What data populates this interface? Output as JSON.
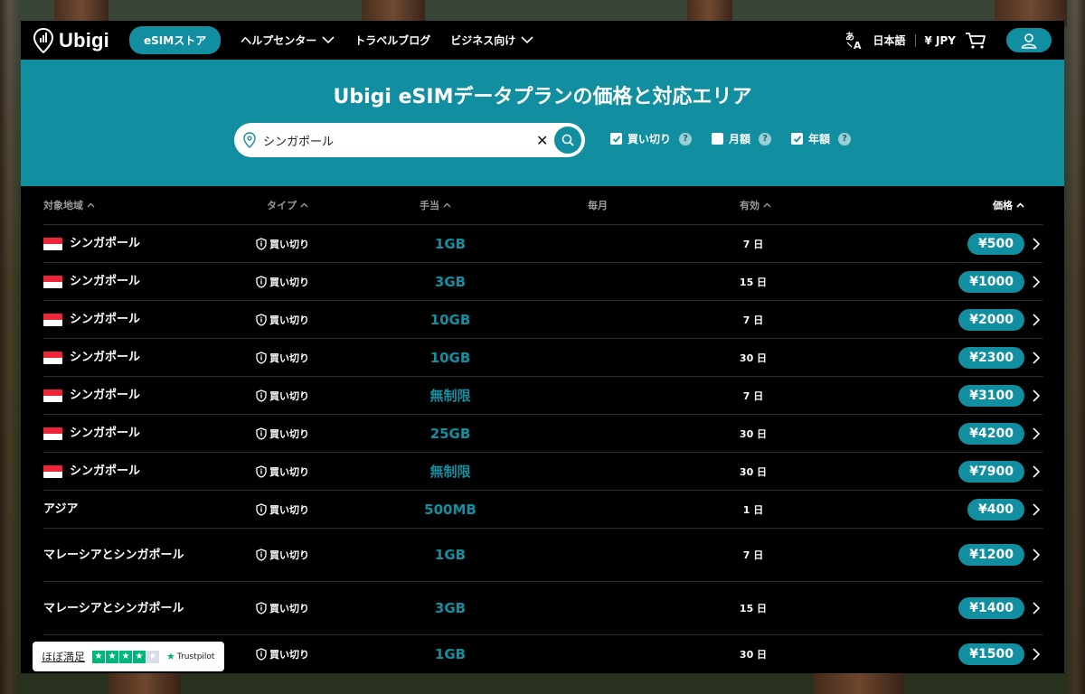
{
  "header": {
    "logo_text": "Ubigi",
    "store_label": "eSIMストア",
    "nav": [
      {
        "label": "ヘルプセンター",
        "dropdown": true
      },
      {
        "label": "トラベルブログ",
        "dropdown": false
      },
      {
        "label": "ビジネス向け",
        "dropdown": true
      }
    ],
    "language": "日本語",
    "currency": "¥ JPY"
  },
  "hero": {
    "title": "Ubigi eSIMデータプランの価格と対応エリア",
    "search_value": "シンガポール",
    "filters": [
      {
        "label": "買い切り",
        "checked": true
      },
      {
        "label": "月額",
        "checked": false
      },
      {
        "label": "年額",
        "checked": true
      }
    ]
  },
  "table": {
    "headers": {
      "region": "対象地域",
      "type": "タイプ",
      "allowance": "手当",
      "monthly": "毎月",
      "validity": "有効",
      "price": "価格"
    },
    "rows": [
      {
        "region": "シンガポール",
        "flag": true,
        "type": "買い切り",
        "allowance": "1GB",
        "validity": "7 日",
        "price": "¥500"
      },
      {
        "region": "シンガポール",
        "flag": true,
        "type": "買い切り",
        "allowance": "3GB",
        "validity": "15 日",
        "price": "¥1000"
      },
      {
        "region": "シンガポール",
        "flag": true,
        "type": "買い切り",
        "allowance": "10GB",
        "validity": "7 日",
        "price": "¥2000"
      },
      {
        "region": "シンガポール",
        "flag": true,
        "type": "買い切り",
        "allowance": "10GB",
        "validity": "30 日",
        "price": "¥2300"
      },
      {
        "region": "シンガポール",
        "flag": true,
        "type": "買い切り",
        "allowance": "無制限",
        "validity": "7 日",
        "price": "¥3100"
      },
      {
        "region": "シンガポール",
        "flag": true,
        "type": "買い切り",
        "allowance": "25GB",
        "validity": "30 日",
        "price": "¥4200"
      },
      {
        "region": "シンガポール",
        "flag": true,
        "type": "買い切り",
        "allowance": "無制限",
        "validity": "30 日",
        "price": "¥7900"
      },
      {
        "region": "アジア",
        "flag": false,
        "type": "買い切り",
        "allowance": "500MB",
        "validity": "1 日",
        "price": "¥400"
      },
      {
        "region": "マレーシアとシンガポール",
        "flag": false,
        "type": "買い切り",
        "allowance": "1GB",
        "validity": "7 日",
        "price": "¥1200"
      },
      {
        "region": "マレーシアとシンガポール",
        "flag": false,
        "type": "買い切り",
        "allowance": "3GB",
        "validity": "15 日",
        "price": "¥1400"
      },
      {
        "region": "",
        "flag": false,
        "type": "買い切り",
        "allowance": "1GB",
        "validity": "30 日",
        "price": "¥1500"
      }
    ]
  },
  "trustpilot": {
    "rating_text": "ほぼ満足",
    "stars_filled": 4,
    "stars_total": 5,
    "brand": "Trustpilot"
  },
  "colors": {
    "accent": "#118fa0",
    "background": "#000000",
    "flag_red": "#ee2536",
    "trustpilot_green": "#00b67a"
  }
}
